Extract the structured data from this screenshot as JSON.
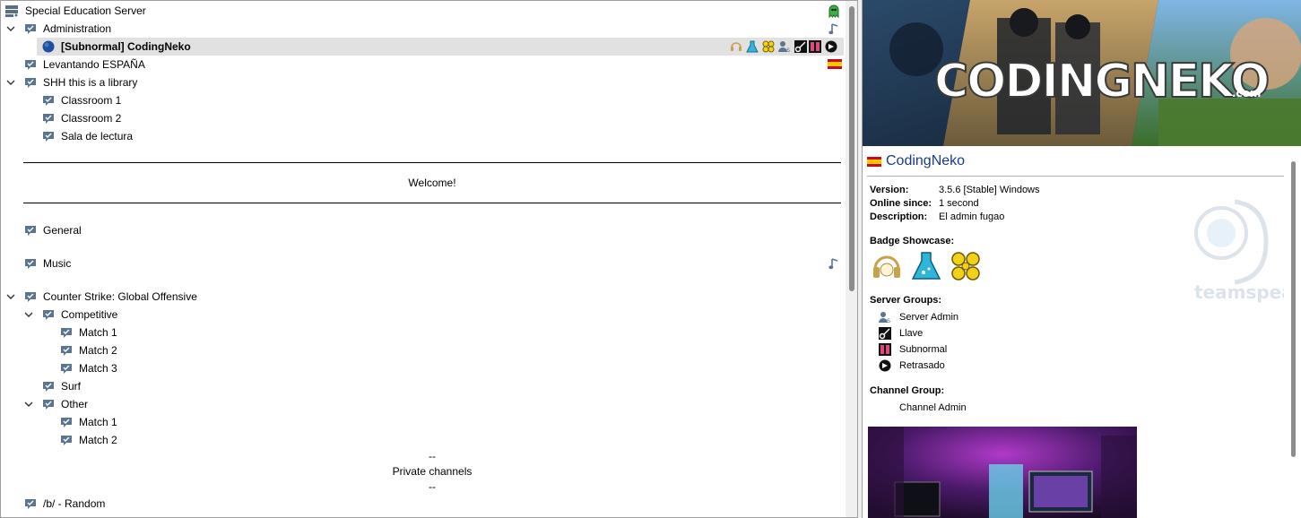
{
  "tree": {
    "server_name": "Special Education Server",
    "channels_top": [
      {
        "label": "Administration"
      },
      {
        "label": "[Subnormal] CodingNeko"
      },
      {
        "label": "Levantando ESPAÑA"
      },
      {
        "label": "SHH this is a library"
      },
      {
        "label": "Classroom 1"
      },
      {
        "label": "Classroom 2"
      },
      {
        "label": "Sala de lectura"
      }
    ],
    "spacer_welcome": "Welcome!",
    "general": "General",
    "music": "Music",
    "csgo": "Counter Strike: Global Offensive",
    "competitive": "Competitive",
    "match1": "Match 1",
    "match2": "Match 2",
    "match3": "Match 3",
    "surf": "Surf",
    "other": "Other",
    "other_match1": "Match 1",
    "other_match2": "Match 2",
    "dash1": "--",
    "private_channels": "Private channels",
    "dash2": "--",
    "random": "/b/ - Random"
  },
  "info": {
    "banner_text": "CODINGNEKO",
    "banner_suffix": ".com",
    "nickname": "CodingNeko",
    "version_label": "Version:",
    "version_value": "3.5.6 [Stable] Windows",
    "online_label": "Online since:",
    "online_value": "1 second",
    "description_label": "Description:",
    "description_value": "El admin fugao",
    "badge_showcase_label": "Badge Showcase:",
    "server_groups_label": "Server Groups:",
    "server_groups": [
      "Server Admin",
      "Llave",
      "Subnormal",
      "Retrasado"
    ],
    "channel_group_label": "Channel Group:",
    "channel_group": "Channel Admin",
    "watermark_text": "teamspeak"
  },
  "colors": {
    "selected_row": "#e1e1e1",
    "nick_color": "#1a3a8c",
    "channel_icon": "#4a6a8a"
  }
}
